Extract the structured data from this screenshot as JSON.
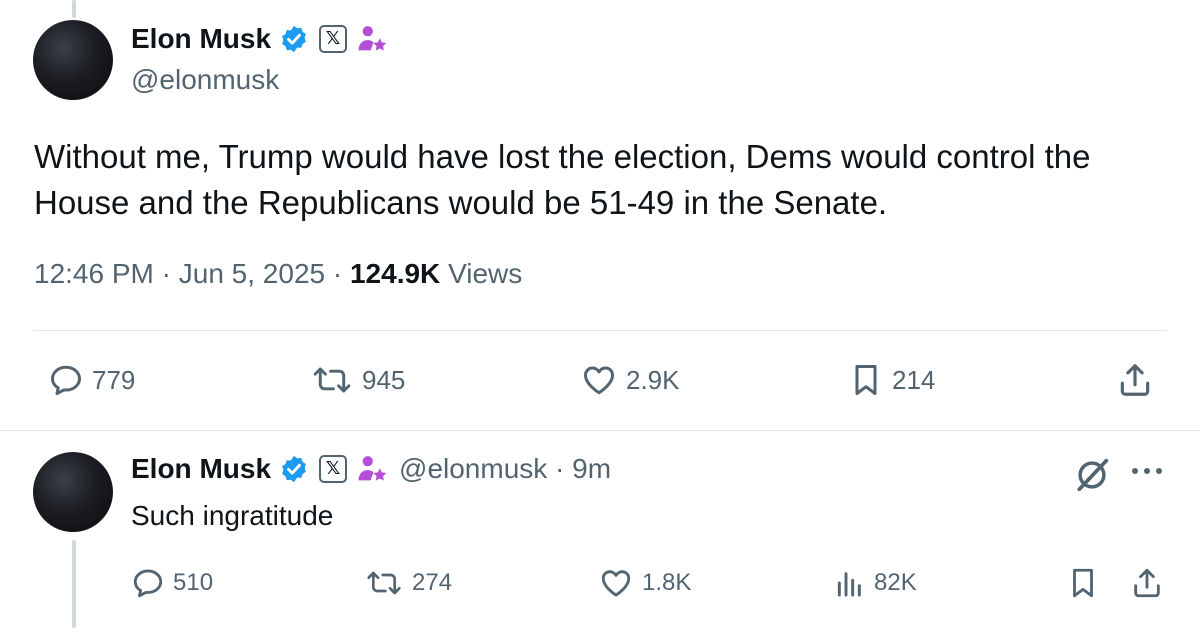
{
  "main_tweet": {
    "author": {
      "name": "Elon Musk",
      "handle": "@elonmusk"
    },
    "text": "Without me, Trump would have lost the election, Dems would control the House and the Republicans would be 51-49 in the Senate.",
    "time": "12:46 PM",
    "date": "Jun 5, 2025",
    "views_count": "124.9K",
    "views_label": "Views",
    "metrics": {
      "replies": "779",
      "reposts": "945",
      "likes": "2.9K",
      "bookmarks": "214"
    }
  },
  "reply_tweet": {
    "author": {
      "name": "Elon Musk",
      "handle": "@elonmusk"
    },
    "age": "9m",
    "text": "Such ingratitude",
    "metrics": {
      "replies": "510",
      "reposts": "274",
      "likes": "1.8K",
      "views": "82K"
    }
  },
  "badges": {
    "x_logo": "𝕏"
  },
  "colors": {
    "verified": "#1d9bf0",
    "muted": "#536471",
    "badge_purple": "#b34fd6",
    "text": "#0f1419"
  },
  "icons": [
    "verified-badge-icon",
    "x-logo-icon",
    "person-star-icon",
    "reply-icon",
    "repost-icon",
    "like-icon",
    "bookmark-icon",
    "share-icon",
    "views-icon",
    "grok-icon",
    "more-icon"
  ]
}
